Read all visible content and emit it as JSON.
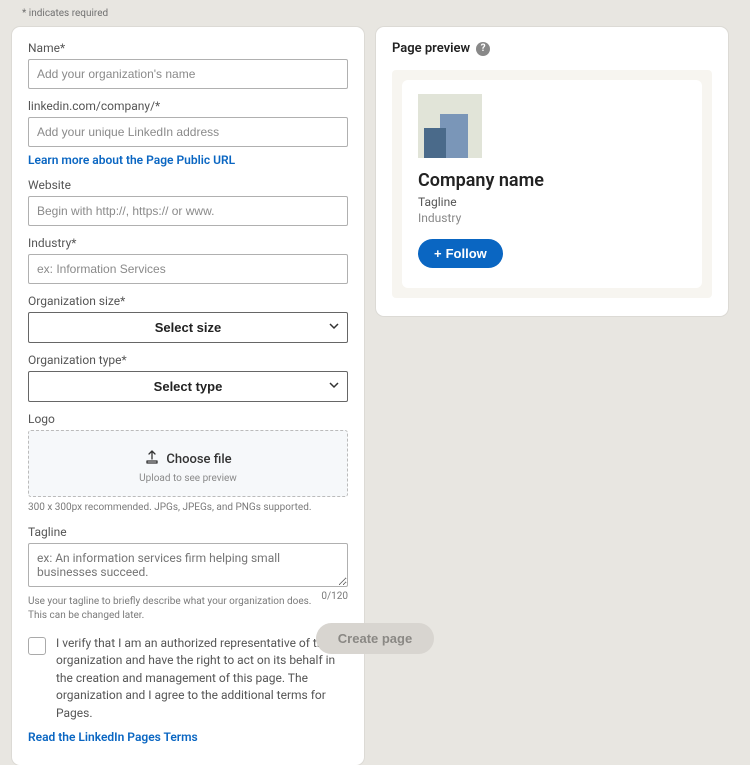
{
  "header": {
    "required_note": "* indicates required"
  },
  "form": {
    "name": {
      "label": "Name*",
      "placeholder": "Add your organization's name"
    },
    "url": {
      "label": "linkedin.com/company/*",
      "placeholder": "Add your unique LinkedIn address",
      "link": "Learn more about the Page Public URL"
    },
    "website": {
      "label": "Website",
      "placeholder": "Begin with http://, https:// or www."
    },
    "industry": {
      "label": "Industry*",
      "placeholder": "ex: Information Services"
    },
    "size": {
      "label": "Organization size*",
      "value": "Select size"
    },
    "type": {
      "label": "Organization type*",
      "value": "Select type"
    },
    "logo": {
      "label": "Logo",
      "choose": "Choose file",
      "sub": "Upload to see preview",
      "hint": "300 x 300px recommended. JPGs, JPEGs, and PNGs supported."
    },
    "tagline": {
      "label": "Tagline",
      "placeholder": "ex: An information services firm helping small businesses succeed.",
      "hint": "Use your tagline to briefly describe what your organization does. This can be changed later.",
      "counter": "0/120"
    },
    "verify": {
      "text": "I verify that I am an authorized representative of this organization and have the right to act on its behalf in the creation and management of this page. The organization and I agree to the additional terms for Pages.",
      "link": "Read the LinkedIn Pages Terms"
    }
  },
  "preview": {
    "title": "Page preview",
    "help": "?",
    "company_name": "Company name",
    "tagline": "Tagline",
    "industry": "Industry",
    "follow": "Follow"
  },
  "footer": {
    "create": "Create page"
  }
}
